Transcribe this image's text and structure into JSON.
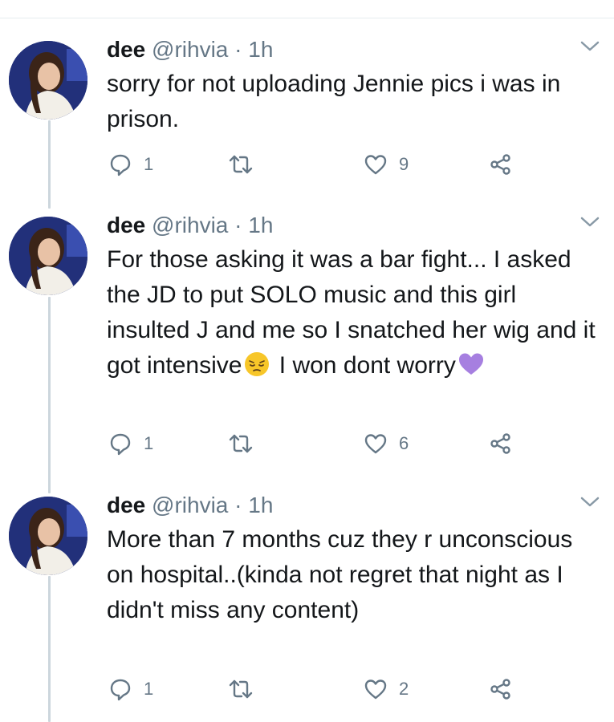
{
  "tweets": [
    {
      "name": "dee",
      "handle": "@rihvia",
      "separator": "·",
      "time": "1h",
      "text": "sorry for not uploading Jennie pics i was in prison.",
      "replies": "1",
      "likes": "9"
    },
    {
      "name": "dee",
      "handle": "@rihvia",
      "separator": "·",
      "time": "1h",
      "text_a": "For those asking it was a bar fight... I asked the JD to put SOLO music and this girl insulted J and me so I snatched her wig and it got intensive",
      "text_b": " I won dont worry",
      "emojis": [
        "pensive-face-emoji",
        "purple-heart-emoji"
      ],
      "replies": "1",
      "likes": "6"
    },
    {
      "name": "dee",
      "handle": "@rihvia",
      "separator": "·",
      "time": "1h",
      "text": "More than 7 months cuz they r unconscious on hospital..(kinda not regret that night as I didn't miss any content)",
      "replies": "1",
      "likes": "2"
    }
  ],
  "icons": [
    "chevron-down-icon",
    "reply-icon",
    "retweet-icon",
    "like-icon",
    "share-icon"
  ],
  "colors": {
    "text": "#14171a",
    "secondary": "#657786",
    "thread_line": "#ccd6dd",
    "purple_heart": "#a67fe0",
    "emoji_yellow": "#f7c629"
  }
}
